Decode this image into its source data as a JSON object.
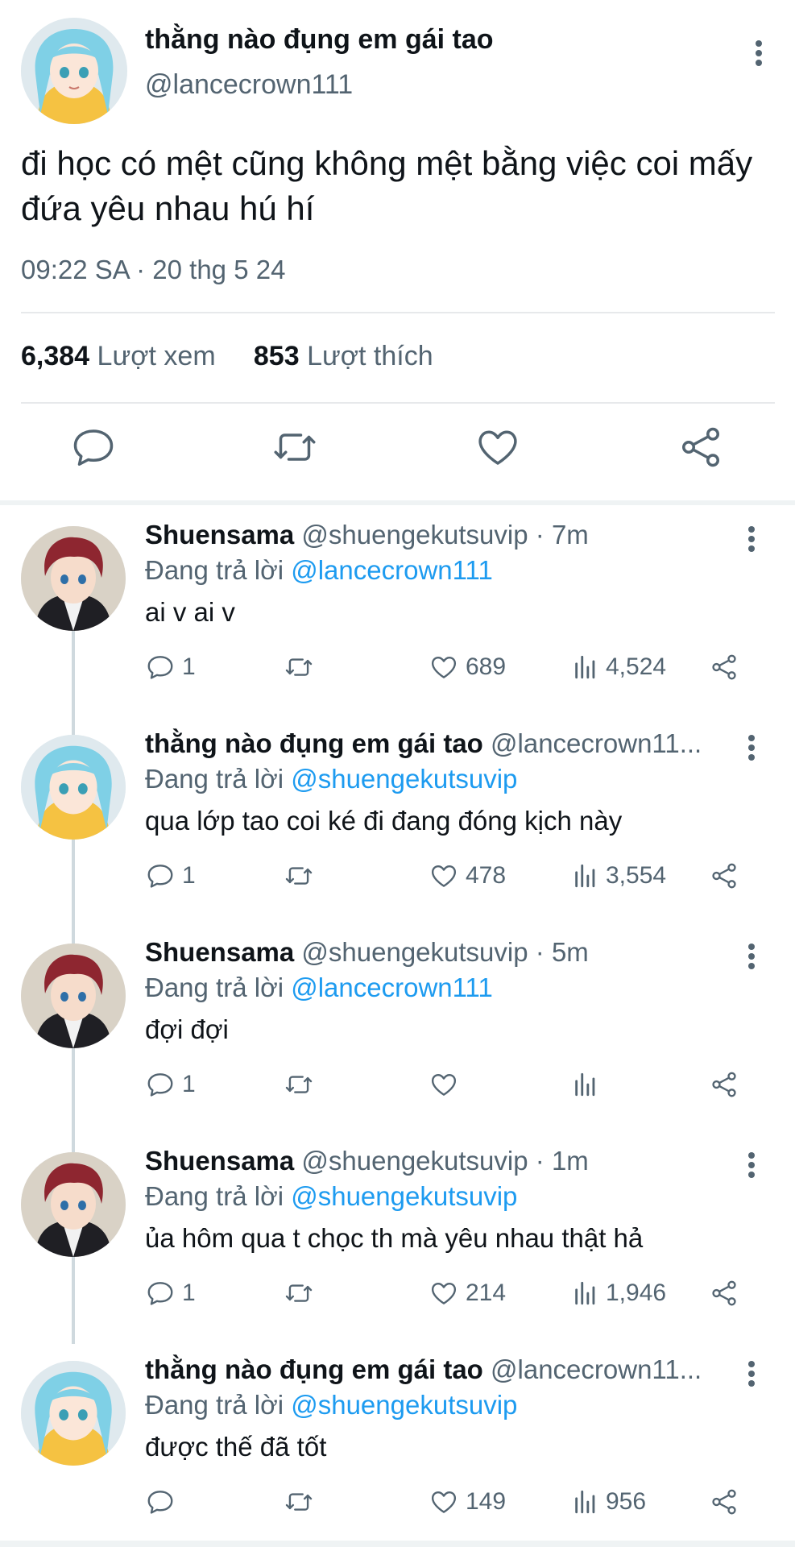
{
  "tweet": {
    "author_name": "thằng nào đụng em gái tao",
    "author_handle": "@lancecrown111",
    "text": "đi học có mệt cũng không mệt bằng việc coi mấy đứa yêu nhau hú hí",
    "timestamp": "09:22 SA · 20 thg 5 24",
    "views_count": "6,384",
    "views_label": "Lượt xem",
    "likes_count": "853",
    "likes_label": "Lượt thích"
  },
  "replies": [
    {
      "name": "Shuensama",
      "handle": "@shuengekutsuvip",
      "time": "· 7m",
      "replying_label": "Đang trả lời",
      "replying_to": "@lancecrown111",
      "text": "ai v ai v",
      "replies": "1",
      "retweets": "",
      "likes": "689",
      "views": "4,524"
    },
    {
      "name": "thằng nào đụng em gái tao",
      "handle": "@lancecrown11...",
      "time": "",
      "replying_label": "Đang trả lời",
      "replying_to": "@shuengekutsuvip",
      "text": "qua lớp tao coi ké đi đang đóng kịch này",
      "replies": "1",
      "retweets": "",
      "likes": "478",
      "views": "3,554"
    },
    {
      "name": "Shuensama",
      "handle": "@shuengekutsuvip",
      "time": "· 5m",
      "replying_label": "Đang trả lời",
      "replying_to": "@lancecrown111",
      "text": "đợi đợi",
      "replies": "1",
      "retweets": "",
      "likes": "",
      "views": ""
    },
    {
      "name": "Shuensama",
      "handle": "@shuengekutsuvip",
      "time": "· 1m",
      "replying_label": "Đang trả lời",
      "replying_to": "@shuengekutsuvip",
      "text": "ủa hôm qua t chọc th mà yêu nhau thật hả",
      "replies": "1",
      "retweets": "",
      "likes": "214",
      "views": "1,946"
    },
    {
      "name": "thằng nào đụng em gái tao",
      "handle": "@lancecrown11...",
      "time": "",
      "replying_label": "Đang trả lời",
      "replying_to": "@shuengekutsuvip",
      "text": "được thế đã tốt",
      "replies": "",
      "retweets": "",
      "likes": "149",
      "views": "956"
    }
  ],
  "colors": {
    "accent": "#1d9bf0",
    "muted": "#536471",
    "text": "#0f1419"
  },
  "icons": [
    "more-vertical-icon",
    "reply-icon",
    "retweet-icon",
    "like-icon",
    "share-icon",
    "views-icon"
  ]
}
